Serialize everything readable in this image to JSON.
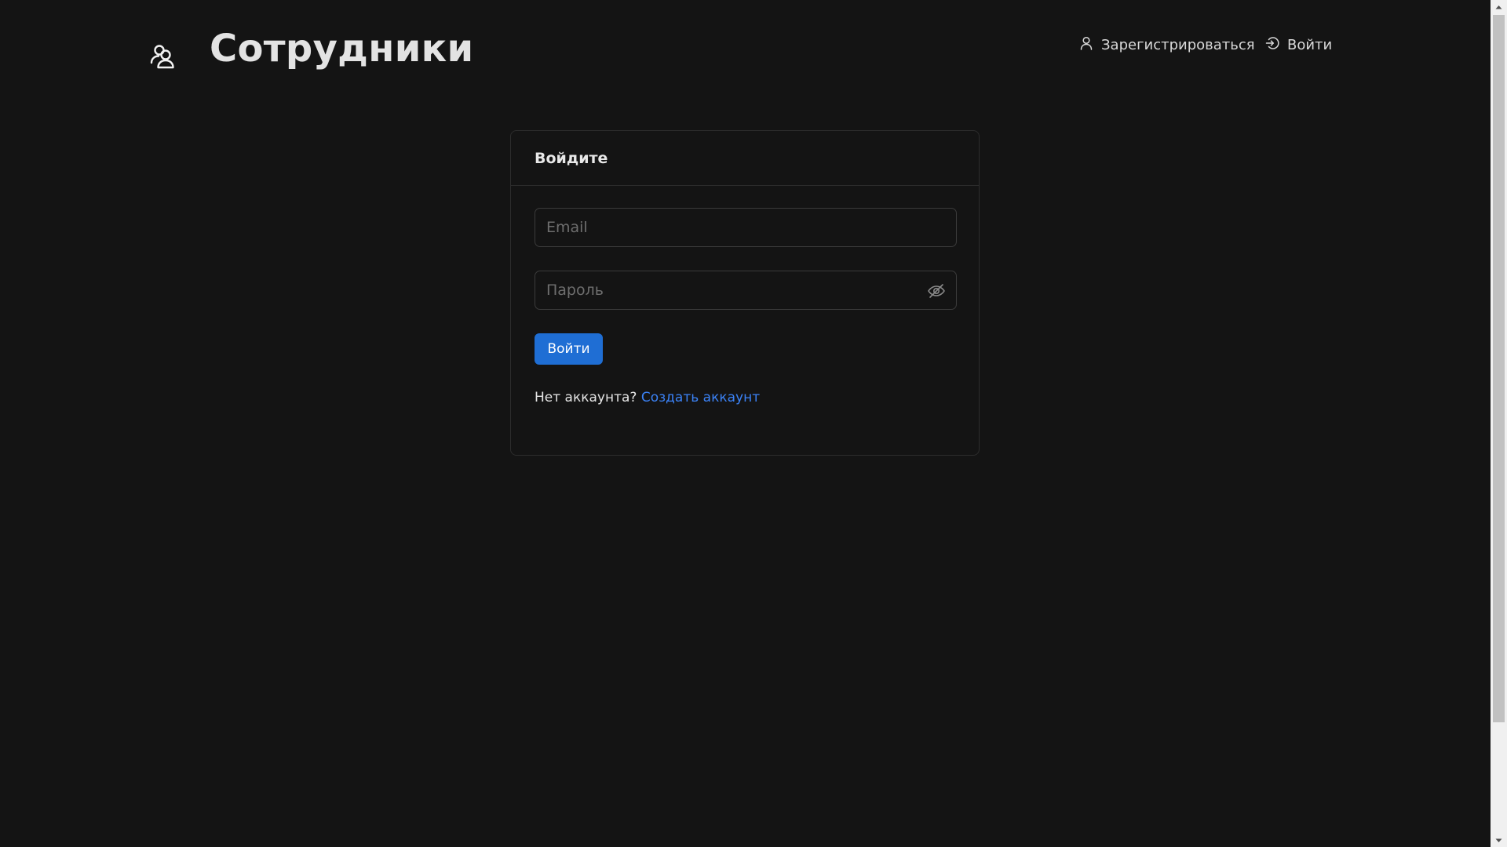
{
  "header": {
    "app_title": "Сотрудники",
    "logo_icon": "users-icon",
    "nav": {
      "register_label": "Зарегистрироваться",
      "register_icon": "user-icon",
      "login_label": "Войти",
      "login_icon": "sign-in-icon"
    }
  },
  "login_card": {
    "title": "Войдите",
    "email": {
      "value": "",
      "placeholder": "Email"
    },
    "password": {
      "value": "",
      "placeholder": "Пароль",
      "toggle_icon": "eye-slash-icon"
    },
    "submit_label": "Войти",
    "no_account_text": "Нет аккаунта?",
    "create_account_link": "Создать аккаунт"
  },
  "colors": {
    "background": "#141414",
    "primary_button": "#1f6ed4",
    "link": "#3b82f6",
    "border": "#2c2c2c"
  }
}
